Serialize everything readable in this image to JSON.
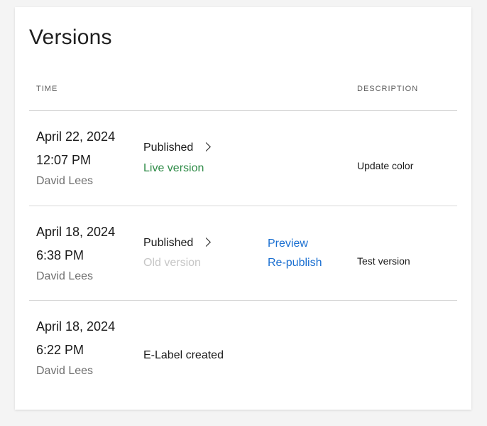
{
  "page": {
    "title": "Versions"
  },
  "table": {
    "headers": {
      "time": "TIME",
      "description": "DESCRIPTION"
    },
    "rows": [
      {
        "date": "April 22, 2024",
        "time": "12:07 PM",
        "author": "David Lees",
        "status": "Published",
        "sub_status": "Live version",
        "description": "Update color"
      },
      {
        "date": "April 18, 2024",
        "time": "6:38 PM",
        "author": "David Lees",
        "status": "Published",
        "sub_status": "Old version",
        "actions": {
          "preview": "Preview",
          "republish": "Re-publish"
        },
        "description": "Test version"
      },
      {
        "date": "April 18, 2024",
        "time": "6:22 PM",
        "author": "David Lees",
        "status": "E-Label created"
      }
    ]
  },
  "colors": {
    "live": "#2e8b47",
    "old": "#c6c6c6",
    "link": "#1a6fd1"
  },
  "icons": {
    "expand": "chevron-right-icon"
  }
}
